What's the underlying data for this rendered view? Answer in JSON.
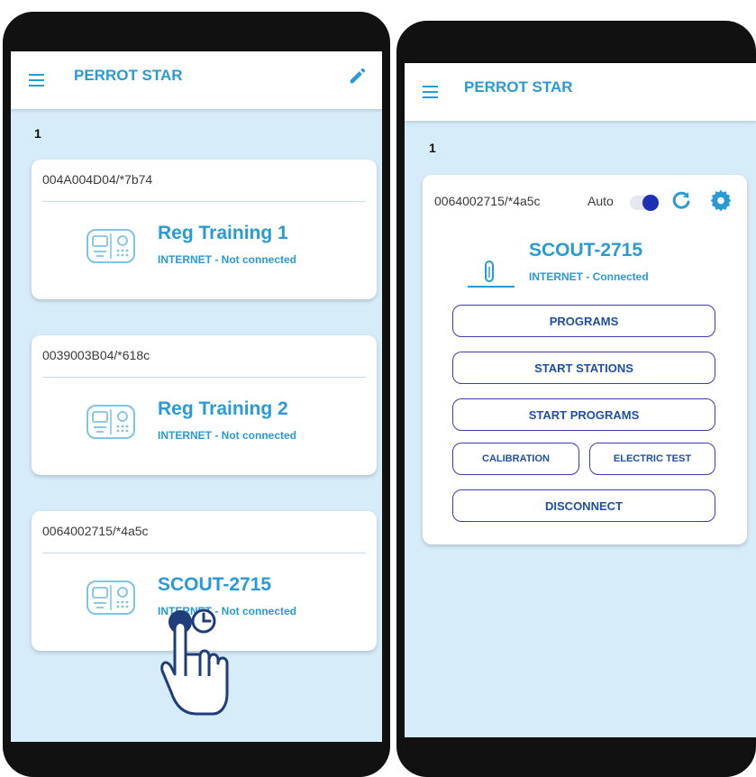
{
  "left": {
    "app_title": "PERROT STAR",
    "page_number": "1",
    "cards": [
      {
        "id": "004A004D04/*7b74",
        "name": "Reg Training 1",
        "status": "INTERNET - Not connected"
      },
      {
        "id": "0039003B04/*618c",
        "name": "Reg Training 2",
        "status": "INTERNET - Not connected"
      },
      {
        "id": "0064002715/*4a5c",
        "name": "SCOUT-2715",
        "status": "INTERNET - Not connected"
      }
    ]
  },
  "right": {
    "app_title": "PERROT STAR",
    "page_number": "1",
    "card": {
      "id": "0064002715/*4a5c",
      "auto_label": "Auto",
      "auto_enabled": true,
      "name": "SCOUT-2715",
      "status": "INTERNET - Connected",
      "buttons": {
        "programs": "PROGRAMS",
        "start_stations": "START STATIONS",
        "start_programs": "START PROGRAMS",
        "calibration": "CALIBRATION",
        "electric_test": "ELECTRIC TEST",
        "disconnect": "DISCONNECT"
      }
    }
  },
  "colors": {
    "accent": "#2a9ad6",
    "background": "#d6ecf9",
    "button_border": "#3b3fae",
    "toggle": "#1d2fb5"
  },
  "icons": [
    "menu-icon",
    "pencil-icon",
    "controller-icon",
    "hand-pointer-icon",
    "timer-icon",
    "refresh-icon",
    "gear-icon",
    "sensor-icon"
  ]
}
